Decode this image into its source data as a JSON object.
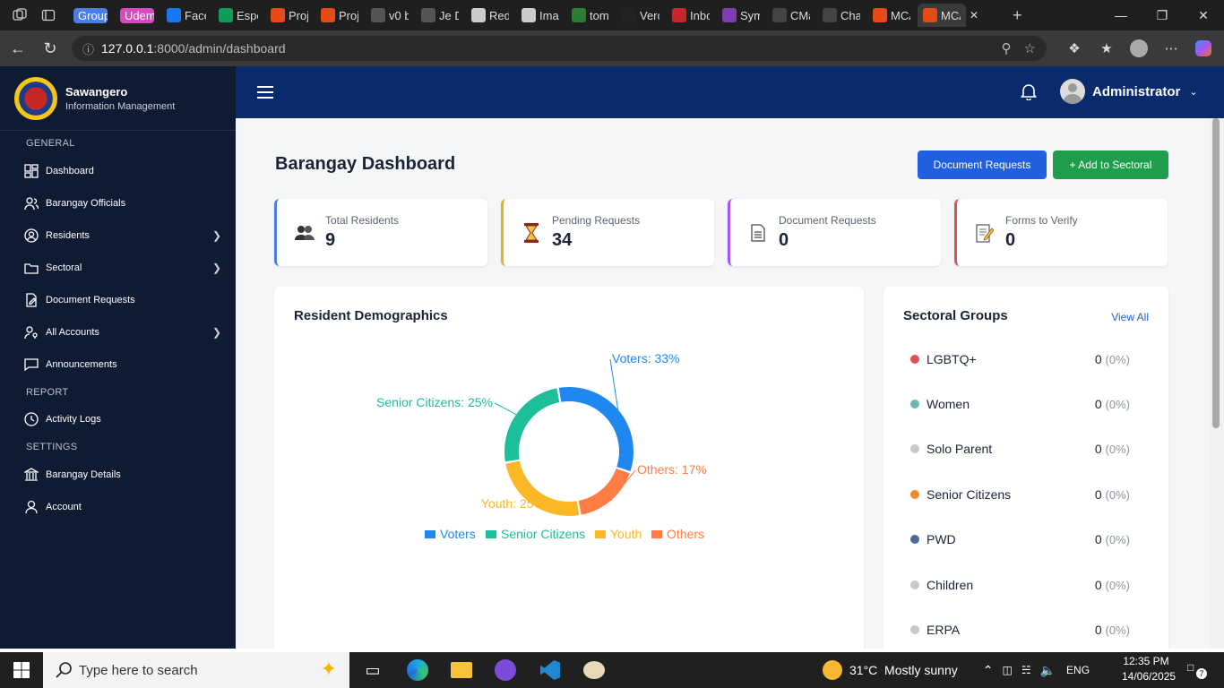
{
  "browser": {
    "tabs": [
      {
        "label": "Group",
        "color": "#4a7de8",
        "pill": true
      },
      {
        "label": "Udem",
        "color": "#d84ac0",
        "pill": true
      },
      {
        "label": "Face",
        "color": "#1877f2"
      },
      {
        "label": "Espe",
        "color": "#0f9d58"
      },
      {
        "label": "Proj",
        "color": "#e64a19"
      },
      {
        "label": "Proj",
        "color": "#e64a19"
      },
      {
        "label": "v0 b",
        "color": "#555555"
      },
      {
        "label": "Je D",
        "color": "#555555"
      },
      {
        "label": "Red",
        "color": "#cccccc"
      },
      {
        "label": "Ima",
        "color": "#cccccc"
      },
      {
        "label": "tom",
        "color": "#2e7d32"
      },
      {
        "label": "Verc",
        "color": "#222222"
      },
      {
        "label": "Inbc",
        "color": "#c62828"
      },
      {
        "label": "Sym",
        "color": "#7b3fb0"
      },
      {
        "label": "CMa",
        "color": "#444444"
      },
      {
        "label": "Cha",
        "color": "#444444"
      },
      {
        "label": "MCA",
        "color": "#e64a19"
      },
      {
        "label": "MCA",
        "color": "#e64a19"
      }
    ],
    "url_host": "127.0.0.1",
    "url_path": ":8000/admin/dashboard"
  },
  "sidebar": {
    "brand_name": "Sawangero",
    "brand_sub": "Information Management",
    "sections": {
      "general": "GENERAL",
      "report": "REPORT",
      "settings": "SETTINGS"
    },
    "items": {
      "dashboard": "Dashboard",
      "officials": "Barangay Officials",
      "residents": "Residents",
      "sectoral": "Sectoral",
      "document_requests": "Document Requests",
      "all_accounts": "All Accounts",
      "announcements": "Announcements",
      "activity_logs": "Activity Logs",
      "barangay_details": "Barangay Details",
      "account": "Account"
    }
  },
  "topbar": {
    "user": "Administrator"
  },
  "page": {
    "title": "Barangay Dashboard",
    "btn_document_requests": "Document Requests",
    "btn_add_sectoral": "+ Add to Sectoral"
  },
  "cards": [
    {
      "label": "Total Residents",
      "value": "9",
      "accent": "#4a7de8"
    },
    {
      "label": "Pending Requests",
      "value": "34",
      "accent": "#e6b020"
    },
    {
      "label": "Document Requests",
      "value": "0",
      "accent": "#a855f7"
    },
    {
      "label": "Forms to Verify",
      "value": "0",
      "accent": "#e0505a"
    }
  ],
  "demographics": {
    "title": "Resident Demographics"
  },
  "chart_data": {
    "type": "pie",
    "categories": [
      "Voters",
      "Senior Citizens",
      "Youth",
      "Others"
    ],
    "values": [
      33,
      25,
      25,
      17
    ],
    "colors": [
      "#1e88f0",
      "#1dbf9a",
      "#fbb726",
      "#ff7d45"
    ],
    "labels": [
      "Voters: 33%",
      "Senior Citizens: 25%",
      "Youth: 25%",
      "Others: 17%"
    ],
    "legend": "bottom"
  },
  "sectoral": {
    "title": "Sectoral Groups",
    "view_all": "View All",
    "groups": [
      {
        "name": "LGBTQ+",
        "count": "0",
        "pct": "(0%)",
        "color": "#e0505a"
      },
      {
        "name": "Women",
        "count": "0",
        "pct": "(0%)",
        "color": "#6fb5b0"
      },
      {
        "name": "Solo Parent",
        "count": "0",
        "pct": "(0%)",
        "color": "#c8c8c8"
      },
      {
        "name": "Senior Citizens",
        "count": "0",
        "pct": "(0%)",
        "color": "#f08a2c"
      },
      {
        "name": "PWD",
        "count": "0",
        "pct": "(0%)",
        "color": "#4a6a9a"
      },
      {
        "name": "Children",
        "count": "0",
        "pct": "(0%)",
        "color": "#c8c8c8"
      },
      {
        "name": "ERPA",
        "count": "0",
        "pct": "(0%)",
        "color": "#c8c8c8"
      }
    ]
  },
  "taskbar": {
    "search_placeholder": "Type here to search",
    "weather": "31°C  Mostly sunny",
    "lang": "ENG",
    "time": "12:35 PM",
    "date": "14/06/2025",
    "notif_count": "7"
  }
}
